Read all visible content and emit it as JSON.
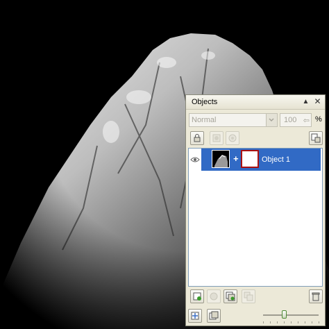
{
  "docker": {
    "title": "Objects",
    "pin_symbol": "▲",
    "close_symbol": "✕",
    "blend_mode": "Normal",
    "opacity": "100",
    "opacity_unit": "%",
    "objects": [
      {
        "name": "Object 1",
        "visible": true,
        "selected": true,
        "link_symbol": "+"
      }
    ],
    "zoom_fraction": 0.38
  },
  "icons": {
    "lock": "lock-icon",
    "mask": "mask-icon",
    "options": "object-options-icon",
    "new_object": "new-object-icon",
    "duplicate": "duplicate-icon",
    "new_mask": "new-mask-icon",
    "combine": "combine-icon",
    "delete": "trash-icon",
    "eye": "eye-icon"
  },
  "colors": {
    "panel_bg": "#ece9d8",
    "selection": "#316ac5",
    "mask_border": "#aa1111"
  }
}
